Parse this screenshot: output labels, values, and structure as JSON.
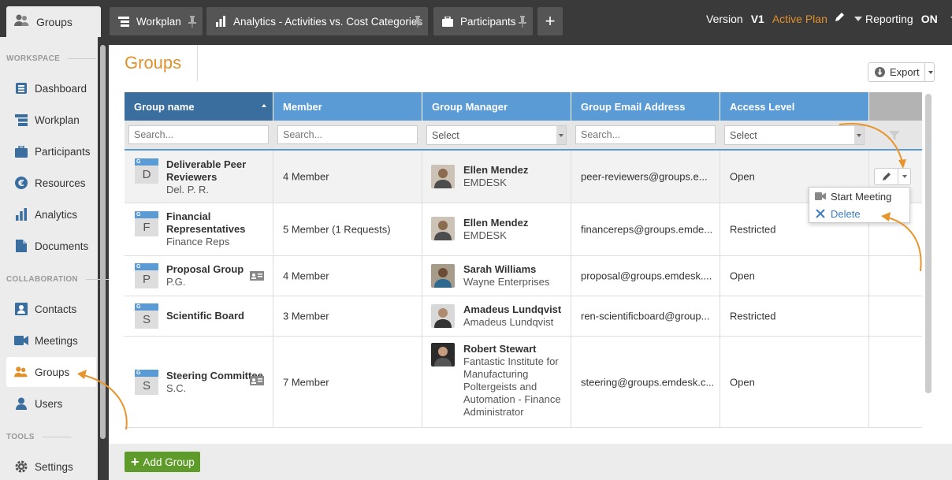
{
  "top": {
    "home_tab": "Groups",
    "tabs": [
      {
        "label": "Workplan",
        "icon": "gantt-icon"
      },
      {
        "label": "Analytics - Activities vs. Cost Categories",
        "icon": "bar-chart-icon"
      },
      {
        "label": "Participants",
        "icon": "briefcase-icon"
      }
    ],
    "version_label": "Version",
    "version_value": "V1",
    "plan_status": "Active Plan",
    "reporting_label": "Reporting",
    "reporting_value": "ON"
  },
  "sidebar": {
    "sections": {
      "workspace": "WORKSPACE",
      "collaboration": "COLLABORATION",
      "tools": "TOOLS"
    },
    "items": [
      {
        "label": "Dashboard",
        "icon": "dashboard-icon"
      },
      {
        "label": "Workplan",
        "icon": "gantt-icon"
      },
      {
        "label": "Participants",
        "icon": "briefcase-icon"
      },
      {
        "label": "Resources",
        "icon": "euro-icon"
      },
      {
        "label": "Analytics",
        "icon": "bar-chart-icon"
      },
      {
        "label": "Documents",
        "icon": "document-icon"
      },
      {
        "label": "Contacts",
        "icon": "contact-card-icon"
      },
      {
        "label": "Meetings",
        "icon": "video-camera-icon"
      },
      {
        "label": "Groups",
        "icon": "groups-icon",
        "active": true
      },
      {
        "label": "Users",
        "icon": "user-icon"
      },
      {
        "label": "Settings",
        "icon": "gear-icon"
      }
    ]
  },
  "main": {
    "title": "Groups",
    "export_label": "Export",
    "columns": [
      "Group name",
      "Member",
      "Group Manager",
      "Group Email Address",
      "Access Level"
    ],
    "filters": {
      "search_placeholder": "Search...",
      "select_label": "Select"
    },
    "rows": [
      {
        "letter": "D",
        "badge": "G",
        "name1": "Deliverable Peer",
        "name2": "Reviewers",
        "abbr": "Del. P. R.",
        "member": "4 Member",
        "manager": "Ellen Mendez",
        "org1": "EMDESK",
        "org2": "",
        "org3": "",
        "org4": "",
        "org5": "",
        "email": "peer-reviewers@groups.e...",
        "access": "Open"
      },
      {
        "letter": "F",
        "badge": "G",
        "name1": "Financial",
        "name2": "Representatives",
        "abbr": "Finance Reps",
        "member": "5 Member (1 Requests)",
        "manager": "Ellen Mendez",
        "org1": "EMDESK",
        "org2": "",
        "org3": "",
        "org4": "",
        "org5": "",
        "email": "financereps@groups.emde...",
        "access": "Restricted"
      },
      {
        "letter": "P",
        "badge": "G",
        "name1": "Proposal Group",
        "name2": "",
        "abbr": "P.G.",
        "member": "4 Member",
        "manager": "Sarah Williams",
        "org1": "Wayne Enterprises",
        "org2": "",
        "org3": "",
        "org4": "",
        "org5": "",
        "email": "proposal@groups.emdesk....",
        "access": "Open"
      },
      {
        "letter": "S",
        "badge": "G",
        "name1": "Scientific Board",
        "name2": "",
        "abbr": "",
        "member": "3 Member",
        "manager": "Amadeus Lundqvist",
        "org1": "Amadeus Lundqvist",
        "org2": "",
        "org3": "",
        "org4": "",
        "org5": "",
        "email": "ren-scientificboard@group...",
        "access": "Restricted"
      },
      {
        "letter": "S",
        "badge": "G",
        "name1": "Steering Committee",
        "name2": "",
        "abbr": "S.C.",
        "member": "7 Member",
        "manager": "Robert Stewart",
        "org1": "Fantastic Institute for",
        "org2": "Manufacturing",
        "org3": "Poltergeists and",
        "org4": "Automation - Finance",
        "org5": "Administrator",
        "email": "steering@groups.emdesk.c...",
        "access": "Open"
      }
    ],
    "row_menu": {
      "start_meeting": "Start Meeting",
      "delete": "Delete"
    },
    "add_group_label": "Add Group"
  },
  "colors": {
    "accent_orange": "#e0912b",
    "header_blue": "#5b9bd5",
    "header_blue_dark": "#3a6e9f",
    "add_green": "#5f9b2b",
    "link_blue": "#3a7dc4"
  }
}
